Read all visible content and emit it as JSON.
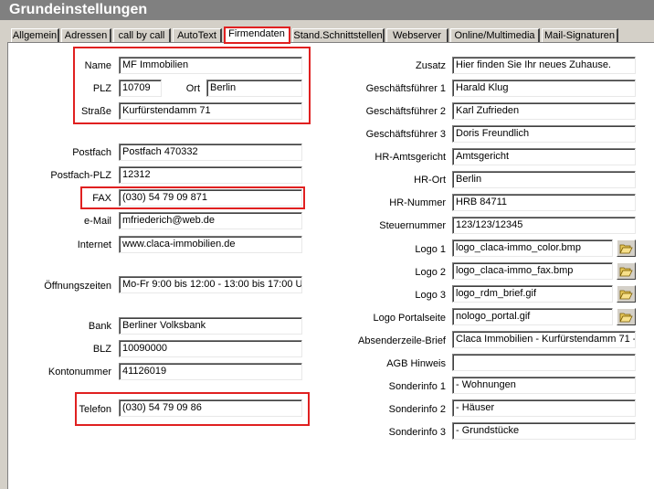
{
  "window": {
    "title": "Grundeinstellungen"
  },
  "tabs": [
    {
      "label": "Allgemein"
    },
    {
      "label": "Adressen"
    },
    {
      "label": "call by call"
    },
    {
      "label": "AutoText"
    },
    {
      "label": "Firmendaten",
      "active": true
    },
    {
      "label": "Stand.Schnittstellen"
    },
    {
      "label": "Webserver"
    },
    {
      "label": "Online/Multimedia"
    },
    {
      "label": "Mail-Signaturen"
    }
  ],
  "left": {
    "name": {
      "label": "Name",
      "value": "MF Immobilien"
    },
    "plz": {
      "label": "PLZ",
      "value": "10709"
    },
    "ort": {
      "label": "Ort",
      "value": "Berlin"
    },
    "strasse": {
      "label": "Straße",
      "value": "Kurfürstendamm 71"
    },
    "postfach": {
      "label": "Postfach",
      "value": "Postfach 470332"
    },
    "postfach_plz": {
      "label": "Postfach-PLZ",
      "value": "12312"
    },
    "fax": {
      "label": "FAX",
      "value": "(030) 54 79 09 871"
    },
    "email": {
      "label": "e-Mail",
      "value": "mfriederich@web.de"
    },
    "internet": {
      "label": "Internet",
      "value": "www.claca-immobilien.de"
    },
    "oeffnungszeiten": {
      "label": "Öffnungszeiten",
      "value": "Mo-Fr 9:00 bis 12:00 - 13:00 bis 17:00 U"
    },
    "bank": {
      "label": "Bank",
      "value": "Berliner Volksbank"
    },
    "blz": {
      "label": "BLZ",
      "value": "10090000"
    },
    "kontonummer": {
      "label": "Kontonummer",
      "value": "41126019"
    },
    "telefon": {
      "label": "Telefon",
      "value": "(030) 54 79 09 86"
    }
  },
  "right": {
    "zusatz": {
      "label": "Zusatz",
      "value": "Hier finden Sie Ihr neues Zuhause."
    },
    "gf1": {
      "label": "Geschäftsführer 1",
      "value": "Harald Klug"
    },
    "gf2": {
      "label": "Geschäftsführer 2",
      "value": "Karl Zufrieden"
    },
    "gf3": {
      "label": "Geschäftsführer 3",
      "value": "Doris Freundlich"
    },
    "hr_amtsgericht": {
      "label": "HR-Amtsgericht",
      "value": "Amtsgericht"
    },
    "hr_ort": {
      "label": "HR-Ort",
      "value": "Berlin"
    },
    "hr_nummer": {
      "label": "HR-Nummer",
      "value": "HRB 84711"
    },
    "steuernummer": {
      "label": "Steuernummer",
      "value": "123/123/12345"
    },
    "logo1": {
      "label": "Logo 1",
      "value": "logo_claca-immo_color.bmp"
    },
    "logo2": {
      "label": "Logo 2",
      "value": "logo_claca-immo_fax.bmp"
    },
    "logo3": {
      "label": "Logo 3",
      "value": "logo_rdm_brief.gif"
    },
    "logo_portal": {
      "label": "Logo Portalseite",
      "value": "nologo_portal.gif"
    },
    "absenderzeile": {
      "label": "Absenderzeile-Brief",
      "value": "Claca Immobilien - Kurfürstendamm 71 - 1"
    },
    "agb": {
      "label": "AGB Hinweis",
      "value": ""
    },
    "sonderinfo1": {
      "label": "Sonderinfo 1",
      "value": "- Wohnungen"
    },
    "sonderinfo2": {
      "label": "Sonderinfo 2",
      "value": "- Häuser"
    },
    "sonderinfo3": {
      "label": "Sonderinfo 3",
      "value": "- Grundstücke"
    }
  },
  "icons": {
    "browse": "folder-open-icon"
  },
  "colors": {
    "highlight": "#e02020",
    "titlebar": "#808080",
    "dialog": "#d4d0c8"
  }
}
